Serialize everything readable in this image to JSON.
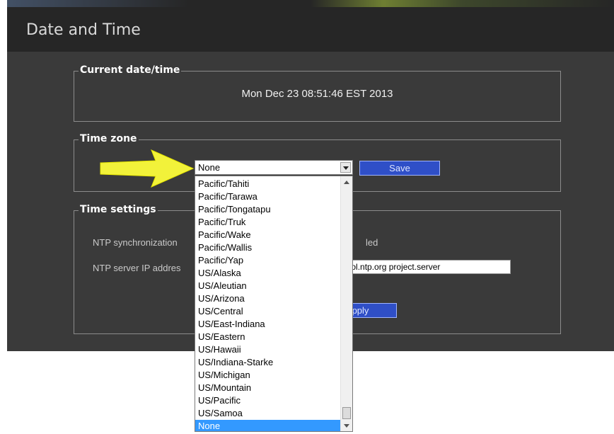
{
  "header": {
    "title": "Date and Time"
  },
  "current": {
    "legend": "Current date/time",
    "value": "Mon Dec 23 08:51:46 EST 2013"
  },
  "timezone": {
    "legend": "Time zone",
    "selected": "None",
    "save_label": "Save",
    "options": [
      "Pacific/Tahiti",
      "Pacific/Tarawa",
      "Pacific/Tongatapu",
      "Pacific/Truk",
      "Pacific/Wake",
      "Pacific/Wallis",
      "Pacific/Yap",
      "US/Alaska",
      "US/Aleutian",
      "US/Arizona",
      "US/Central",
      "US/East-Indiana",
      "US/Eastern",
      "US/Hawaii",
      "US/Indiana-Starke",
      "US/Michigan",
      "US/Mountain",
      "US/Pacific",
      "US/Samoa",
      "None"
    ],
    "highlighted": "None"
  },
  "settings": {
    "legend": "Time settings",
    "ntp_sync_label": "NTP synchronization",
    "ntp_status_partial": "led",
    "ntp_server_label": "NTP server IP addres",
    "ntp_server_value": "om the pool.ntp.org project.server",
    "apply_label": "pply"
  },
  "colors": {
    "background": "#3a3a3a",
    "header": "#262626",
    "button": "#2f4fc7",
    "selection": "#3399ff",
    "annotation_arrow": "#f2f23a"
  }
}
